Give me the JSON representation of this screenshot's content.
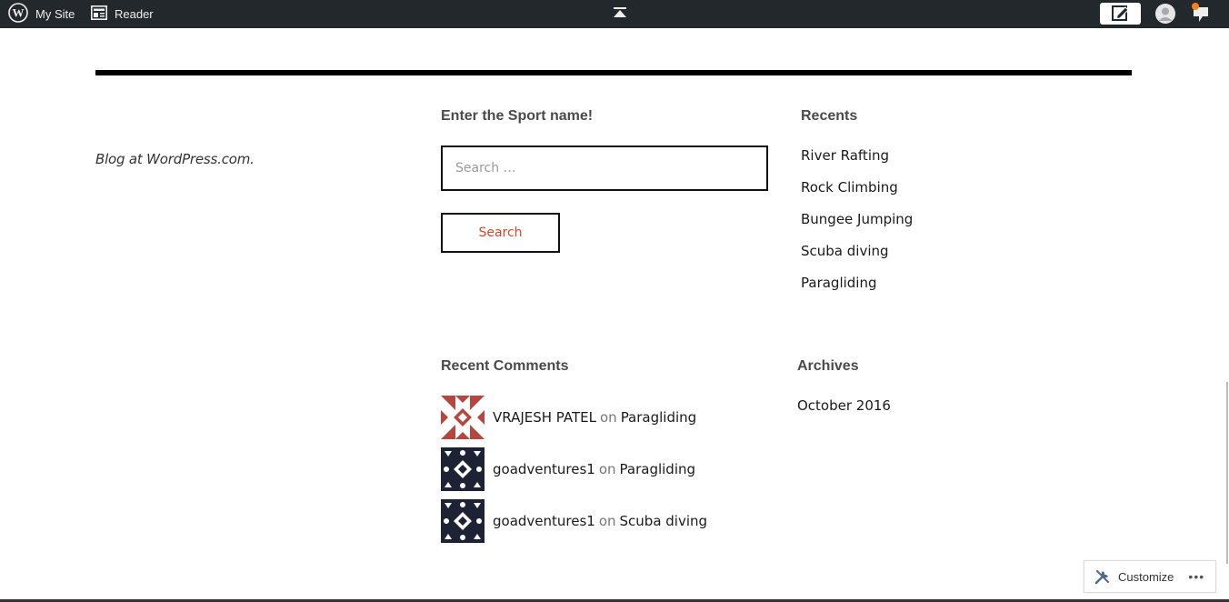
{
  "admin_bar": {
    "my_site_label": "My Site",
    "reader_label": "Reader",
    "icons": [
      "wordpress-logo-icon",
      "reader-icon",
      "scroll-to-top-icon",
      "write-icon",
      "avatar-icon",
      "notifications-icon"
    ],
    "notification_dot_color": "#f0821e"
  },
  "footer": {
    "credit": "Blog at WordPress.com."
  },
  "search_widget": {
    "title": "Enter the Sport name!",
    "placeholder": "Search …",
    "button_label": "Search"
  },
  "recents_widget": {
    "title": "Recents",
    "items": [
      "River Rafting",
      "Rock Climbing",
      "Bungee Jumping",
      "Scuba diving",
      "Paragliding"
    ]
  },
  "recent_comments_widget": {
    "title": "Recent Comments",
    "items": [
      {
        "author": "VRAJESH PATEL",
        "on": "on",
        "post": "Paragliding",
        "avatar_color": "#b5473f"
      },
      {
        "author": "goadventures1",
        "on": "on",
        "post": "Paragliding",
        "avatar_color": "#1e2235"
      },
      {
        "author": "goadventures1",
        "on": "on",
        "post": "Scuba diving",
        "avatar_color": "#1e2235"
      }
    ]
  },
  "archives_widget": {
    "title": "Archives",
    "items": [
      "October 2016"
    ]
  },
  "customize": {
    "label": "Customize",
    "more": "•••"
  },
  "colors": {
    "admin_bar_bg": "#23282d",
    "accent_button_text": "#d4472a"
  }
}
